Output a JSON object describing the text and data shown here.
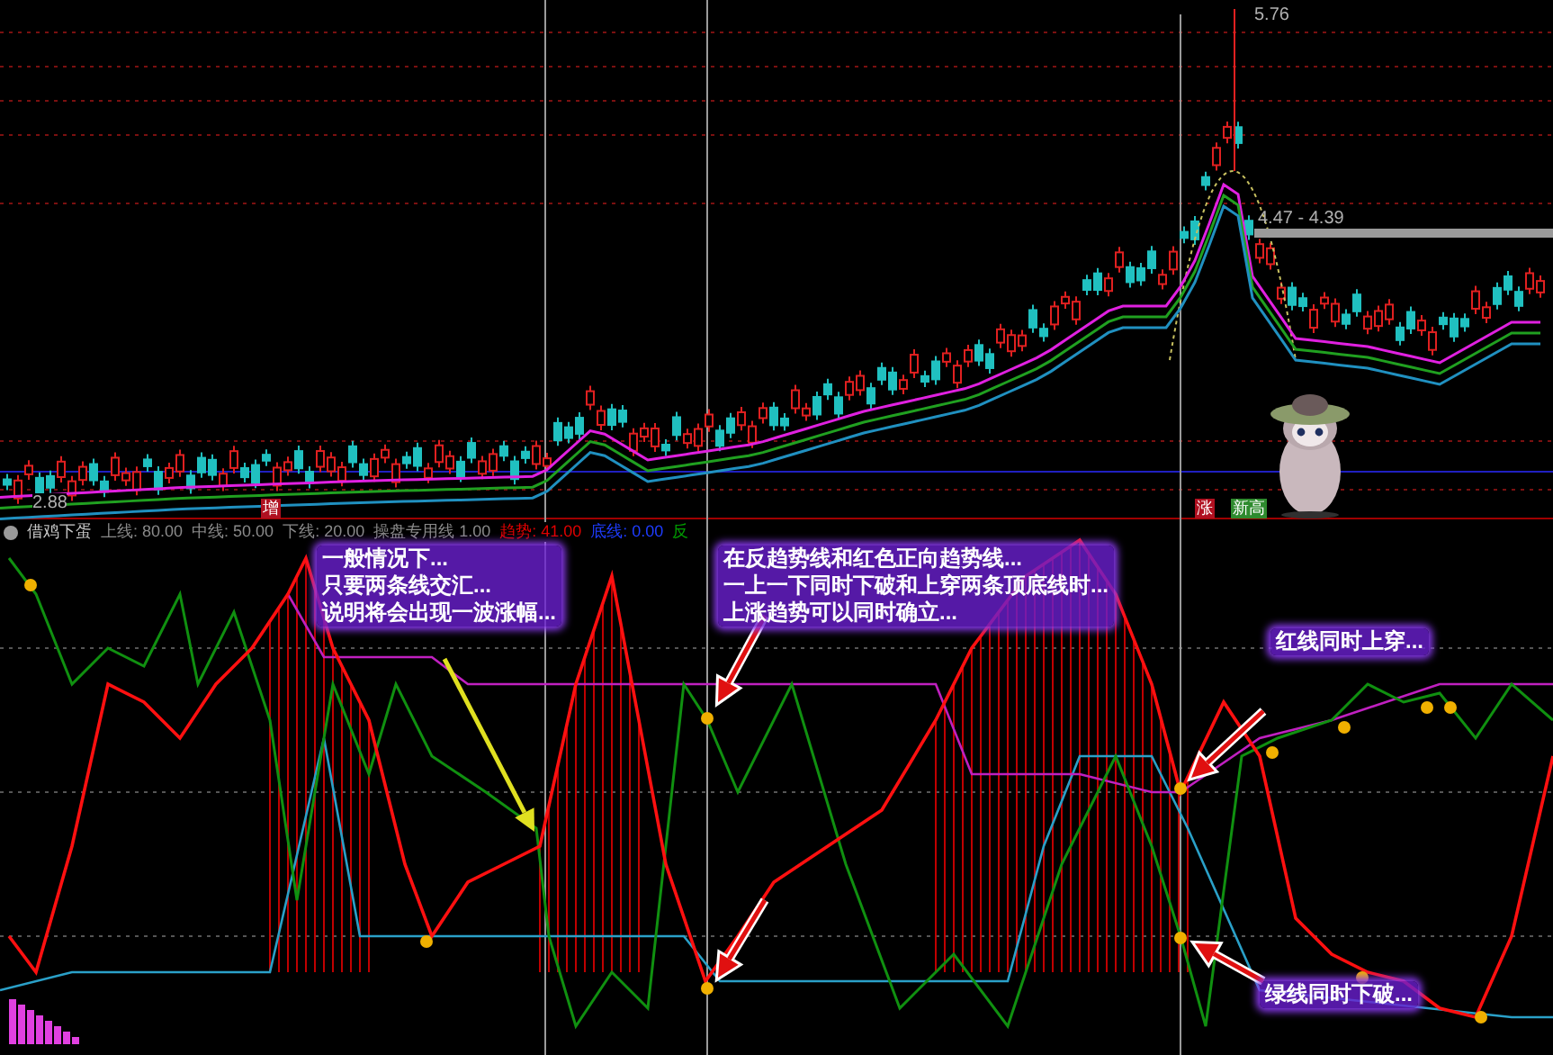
{
  "price_panel": {
    "high_label": "5.76",
    "low_label": "2.88",
    "range_label": "4.47 - 4.39",
    "signals": [
      {
        "text": "增",
        "color": "#b01020"
      },
      {
        "text": "涨",
        "color": "#b01020"
      },
      {
        "text": "新高",
        "color": "#2e8b2e"
      }
    ]
  },
  "indicator_panel": {
    "name": "借鸡下蛋",
    "params": [
      {
        "label": "上线:",
        "value": "80.00",
        "color": "#8a8a8a"
      },
      {
        "label": "中线:",
        "value": "50.00",
        "color": "#8a8a8a"
      },
      {
        "label": "下线:",
        "value": "20.00",
        "color": "#8a8a8a"
      },
      {
        "label": "操盘专用线",
        "value": "1.00",
        "color": "#8a8a8a"
      },
      {
        "label": "趋势:",
        "value": "41.00",
        "color": "#e00000"
      },
      {
        "label": "底线:",
        "value": "0.00",
        "color": "#1e3cff"
      },
      {
        "label": "反",
        "color": "#00a000"
      }
    ],
    "annotations": [
      {
        "kind": "box",
        "lines": [
          "一般情况下...",
          "只要两条线交汇...",
          "说明将会出现一波涨幅..."
        ]
      },
      {
        "kind": "box",
        "lines": [
          "在反趋势线和红色正向趋势线...",
          "一上一下同时下破和上穿两条顶底线时...",
          "上涨趋势可以同时确立..."
        ]
      },
      {
        "kind": "box",
        "lines": [
          "红线同时上穿..."
        ]
      },
      {
        "kind": "box",
        "lines": [
          "绿线同时下破..."
        ]
      }
    ]
  }
}
